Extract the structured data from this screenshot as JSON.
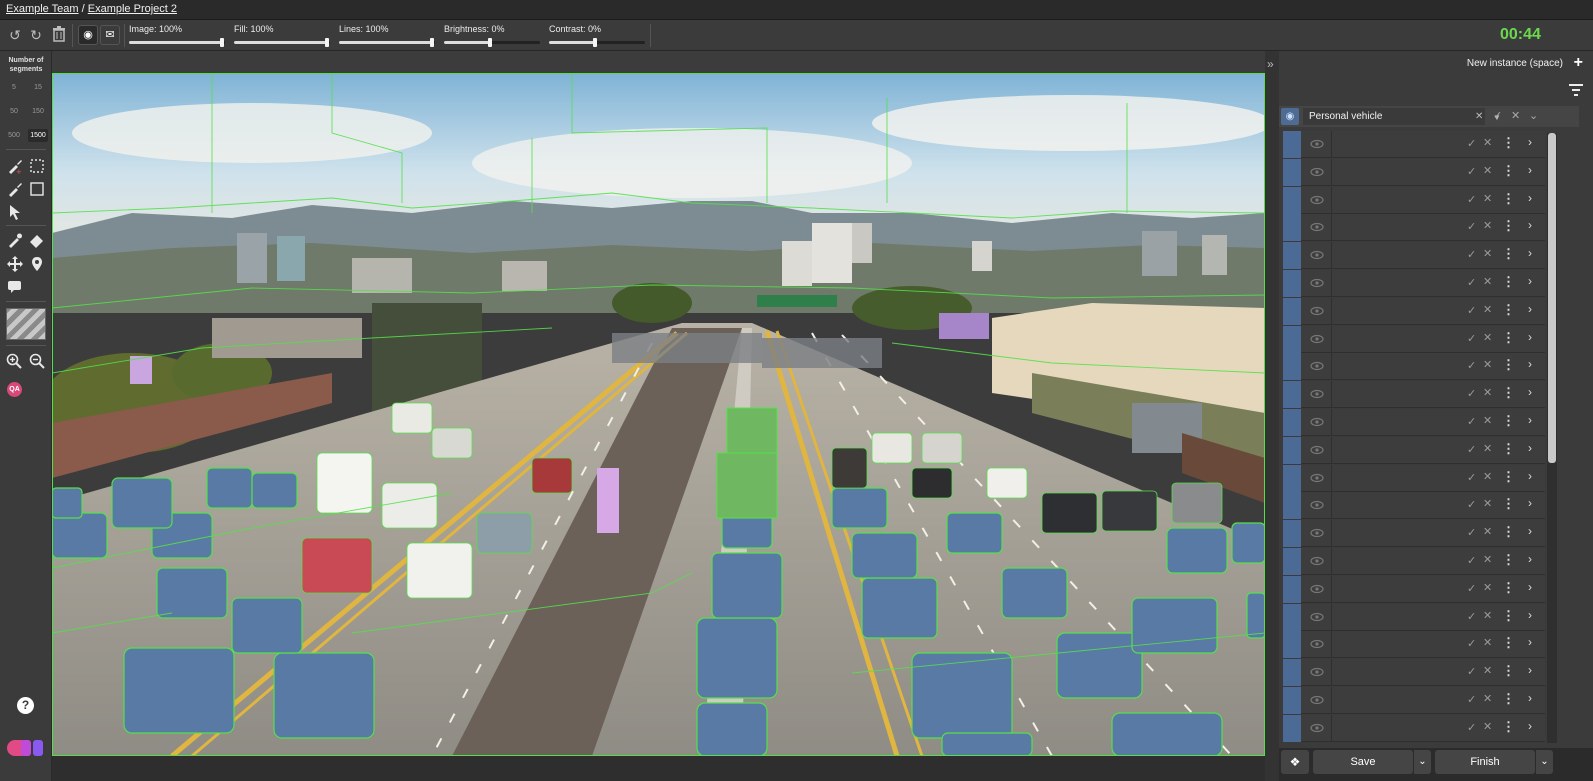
{
  "breadcrumb": {
    "team": "Example Team",
    "separator": "/",
    "project": "Example Project 2"
  },
  "toolbar": {
    "undo_icon": "undo-icon",
    "redo_icon": "redo-icon",
    "delete_icon": "trash-icon",
    "sliders": [
      {
        "label": "Image: 100%",
        "value": 100
      },
      {
        "label": "Fill: 100%",
        "value": 100
      },
      {
        "label": "Lines: 100%",
        "value": 100
      },
      {
        "label": "Brightness: 0%",
        "value": 50
      },
      {
        "label": "Contrast: 0%",
        "value": 50
      }
    ],
    "timer": "00:44"
  },
  "left_tools": {
    "segments_title": "Number of segments",
    "segment_options": [
      "5",
      "15",
      "50",
      "150",
      "500",
      "1500"
    ],
    "segment_selected": "1500",
    "qa_badge": "QA",
    "help": "?"
  },
  "right_panel": {
    "new_instance_label": "New instance (space)",
    "class_name": "Personal vehicle",
    "instance_count": 22,
    "save_label": "Save",
    "finish_label": "Finish"
  },
  "colors": {
    "accent": "#6bd84e",
    "instance": "#4b6a95",
    "outline": "#55e04a",
    "vehicle_fill": "#5a7aa6"
  }
}
